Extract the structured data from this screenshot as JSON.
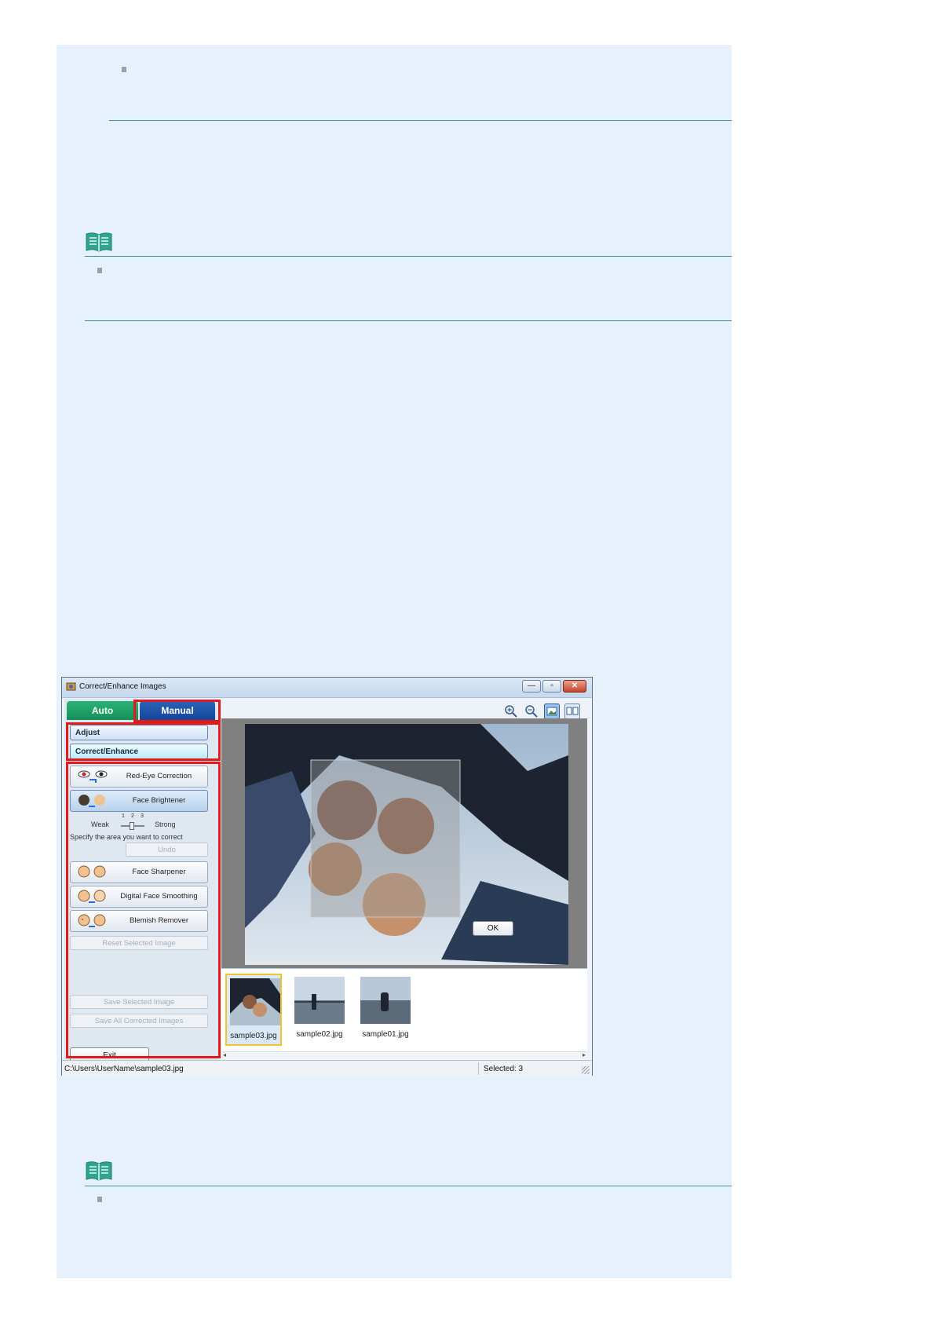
{
  "window": {
    "title": "Correct/Enhance Images",
    "controls": {
      "minimize": "—",
      "maximize": "▫",
      "close": "✕"
    }
  },
  "left_panel": {
    "tabs": {
      "auto": "Auto",
      "manual": "Manual"
    },
    "menu": {
      "adjust": "Adjust",
      "correct_enhance": "Correct/Enhance"
    },
    "functions": {
      "red_eye": "Red-Eye Correction",
      "face_brightener": "Face Brightener",
      "face_sharpener": "Face Sharpener",
      "digital_face_smoothing": "Digital Face Smoothing",
      "blemish_remover": "Blemish Remover"
    },
    "slider": {
      "weak": "Weak",
      "strong": "Strong",
      "ticks": [
        "1",
        "2",
        "3"
      ],
      "value": 2
    },
    "hint": "Specify the area you want to correct",
    "undo": "Undo",
    "reset_selected": "Reset Selected Image",
    "save_selected": "Save Selected Image",
    "save_all": "Save All Corrected Images",
    "exit": "Exit"
  },
  "toolbar": {
    "icons": [
      "zoom-in-icon",
      "zoom-out-icon",
      "whole-image-view-icon",
      "compare-view-icon"
    ]
  },
  "preview": {
    "ok": "OK"
  },
  "thumbnails": [
    {
      "name": "sample03.jpg",
      "selected": true
    },
    {
      "name": "sample02.jpg",
      "selected": false
    },
    {
      "name": "sample01.jpg",
      "selected": false
    }
  ],
  "status": {
    "path": "C:\\Users\\UserName\\sample03.jpg",
    "selected": "Selected: 3"
  },
  "colors": {
    "page_bg": "#e6f1fc",
    "rule": "#3a9a8a",
    "highlight": "#e21a1a",
    "auto_tab": "#1ea168",
    "manual_tab": "#1e56a8"
  }
}
